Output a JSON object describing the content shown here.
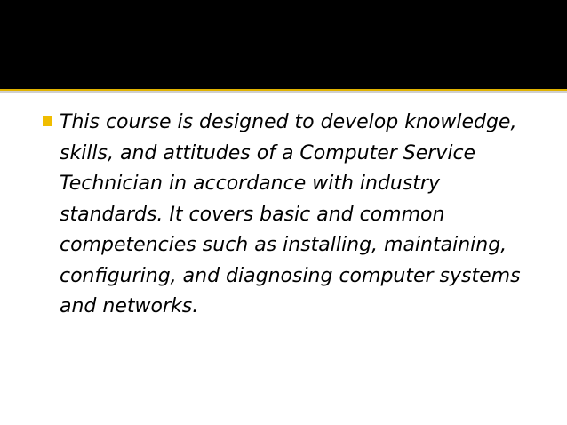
{
  "slide": {
    "bullets": [
      {
        "text": "This course is designed to develop knowledge, skills, and attitudes of a Computer Service Technician in accordance with industry standards. It covers basic and common competencies such as installing, maintaining, configuring, and diagnosing computer systems and networks."
      }
    ]
  },
  "colors": {
    "header_band": "#000000",
    "accent_gold": "#e0b200",
    "bullet": "#f0bd00",
    "text": "#000000",
    "background": "#ffffff"
  }
}
